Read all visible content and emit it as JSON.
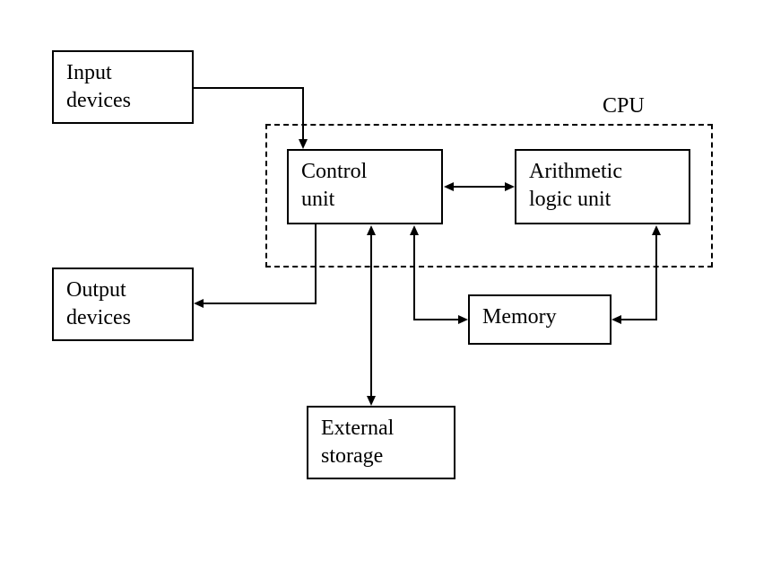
{
  "diagram": {
    "title": "CPU",
    "boxes": {
      "input_devices": "Input\ndevices",
      "output_devices": "Output\ndevices",
      "control_unit": "Control\nunit",
      "alu": "Arithmetic\nlogic unit",
      "memory": "Memory",
      "external_storage": "External\nstorage"
    }
  }
}
